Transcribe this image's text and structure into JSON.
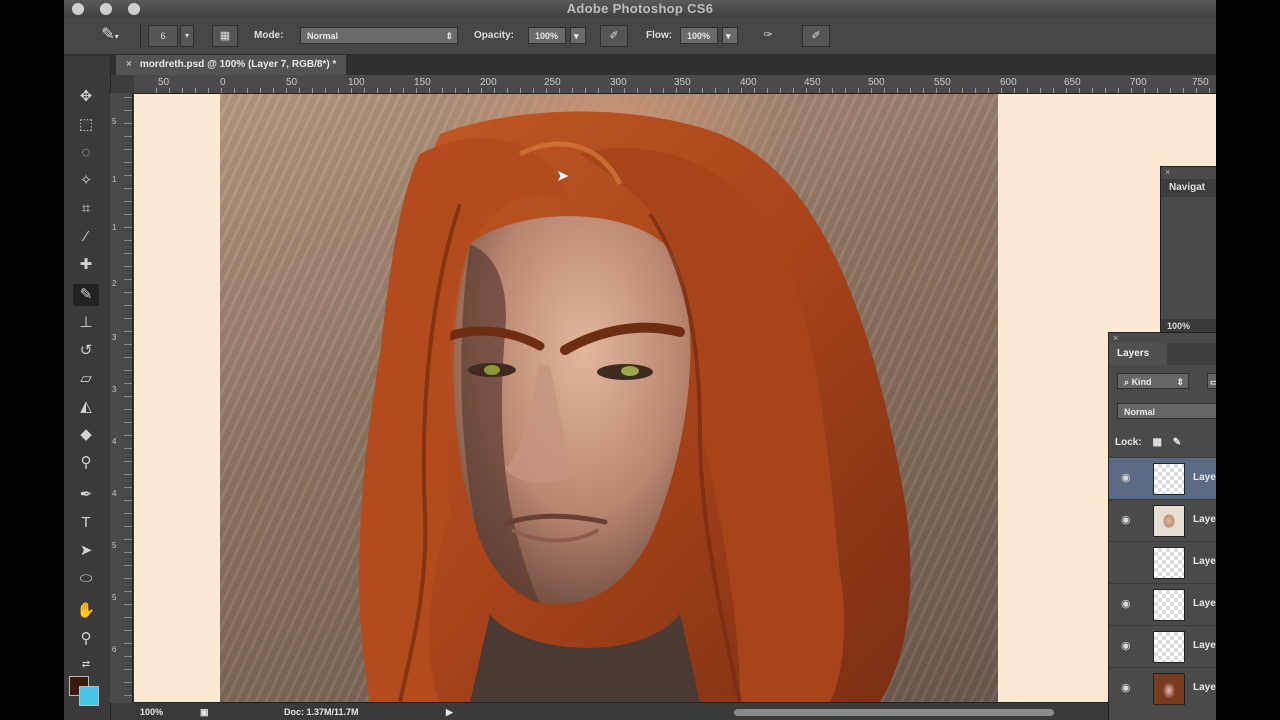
{
  "app": {
    "title": "Adobe Photoshop CS6"
  },
  "options_bar": {
    "brush_size": "6",
    "mode_label": "Mode:",
    "mode_value": "Normal",
    "opacity_label": "Opacity:",
    "opacity_value": "100%",
    "flow_label": "Flow:",
    "flow_value": "100%"
  },
  "document": {
    "tab_title": "mordreth.psd @ 100% (Layer 7, RGB/8*) *"
  },
  "ruler_h": [
    "50",
    "0",
    "50",
    "100",
    "150",
    "200",
    "250",
    "300",
    "350",
    "400",
    "450",
    "500",
    "550",
    "600",
    "650",
    "700",
    "750"
  ],
  "ruler_v": [
    "0",
    "5",
    "1",
    "1",
    "2",
    "3",
    "3",
    "4",
    "4",
    "5",
    "5",
    "6",
    "6",
    "7"
  ],
  "status": {
    "zoom": "100%",
    "doc": "Doc: 1.37M/11.7M"
  },
  "navigator": {
    "tab": "Navigat",
    "zoom": "100%"
  },
  "layers_panel": {
    "tab": "Layers",
    "filter_kind": "Kind",
    "blend_mode": "Normal",
    "lock_label": "Lock:",
    "layers": [
      {
        "name": "Laye",
        "thumb": "transparent",
        "visible": true,
        "selected": true
      },
      {
        "name": "Laye",
        "thumb": "face",
        "visible": true,
        "selected": false
      },
      {
        "name": "Laye",
        "thumb": "transparent",
        "visible": false,
        "selected": false
      },
      {
        "name": "Laye",
        "thumb": "transparent",
        "visible": true,
        "selected": false
      },
      {
        "name": "Laye",
        "thumb": "transparent",
        "visible": true,
        "selected": false
      },
      {
        "name": "Laye",
        "thumb": "face2",
        "visible": true,
        "selected": false
      }
    ]
  },
  "colors": {
    "foreground": "#3b1a0c",
    "background": "#47c4e8",
    "accent_selected_layer": "#5b6a84"
  },
  "icons": {
    "tools": [
      "move-icon",
      "marquee-icon",
      "lasso-icon",
      "quick-select-icon",
      "crop-icon",
      "eyedropper-icon",
      "healing-brush-icon",
      "brush-icon",
      "clone-stamp-icon",
      "history-brush-icon",
      "eraser-icon",
      "paint-bucket-icon",
      "blur-icon",
      "dodge-icon",
      "pen-icon",
      "type-icon",
      "path-select-icon",
      "shape-icon",
      "hand-icon",
      "zoom-icon"
    ]
  }
}
